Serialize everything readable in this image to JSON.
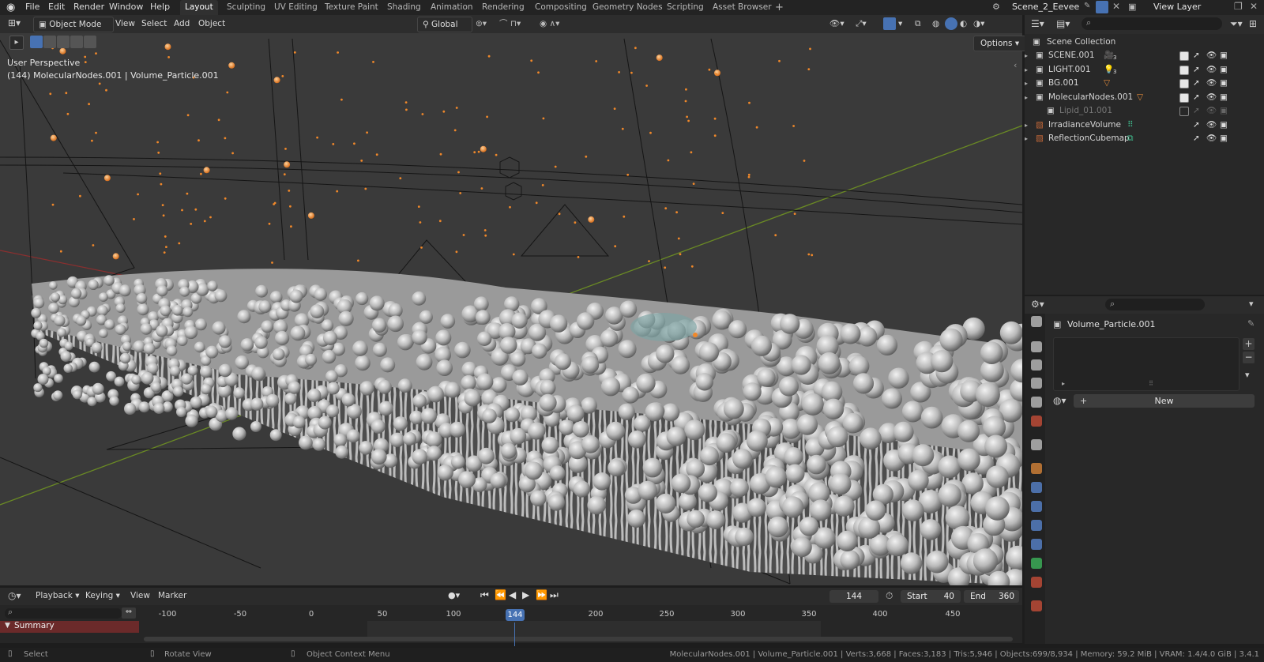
{
  "topbar": {
    "menus": [
      "File",
      "Edit",
      "Render",
      "Window",
      "Help"
    ],
    "workspaces": [
      "Layout",
      "Sculpting",
      "UV Editing",
      "Texture Paint",
      "Shading",
      "Animation",
      "Rendering",
      "Compositing",
      "Geometry Nodes",
      "Scripting",
      "Asset Browser"
    ],
    "active_workspace": "Layout",
    "add_tab": "+",
    "scene_name": "Scene_2_Eevee",
    "view_layer": "View Layer"
  },
  "viewport_header": {
    "mode": "Object Mode",
    "menus": [
      "View",
      "Select",
      "Add",
      "Object"
    ],
    "transform_orientation": "Global",
    "options_label": "Options"
  },
  "viewport_overlay": {
    "view_name": "User Perspective",
    "object_info": "(144) MolecularNodes.001 | Volume_Particle.001"
  },
  "outliner": {
    "root": "Scene Collection",
    "items": [
      {
        "label": "SCENE.001",
        "badge": "3",
        "checked": true,
        "dim": false
      },
      {
        "label": "LIGHT.001",
        "badge": "3",
        "checked": true,
        "dim": false
      },
      {
        "label": "BG.001",
        "badge": "",
        "checked": true,
        "dim": false
      },
      {
        "label": "MolecularNodes.001",
        "badge": "",
        "checked": true,
        "dim": false
      },
      {
        "label": "Lipid_01.001",
        "badge": "",
        "checked": false,
        "dim": true
      },
      {
        "label": "IrradianceVolume",
        "badge": "",
        "checked": null,
        "dim": false
      },
      {
        "label": "ReflectionCubemap",
        "badge": "",
        "checked": null,
        "dim": false
      }
    ]
  },
  "properties": {
    "object_name": "Volume_Particle.001",
    "new_button": "New"
  },
  "timeline": {
    "menus": [
      "Playback",
      "Keying",
      "View",
      "Marker"
    ],
    "current_frame": "144",
    "start_label": "Start",
    "start_value": "40",
    "end_label": "End",
    "end_value": "360",
    "summary_label": "Summary",
    "ticks": [
      "-100",
      "-50",
      "0",
      "50",
      "100",
      "144",
      "200",
      "250",
      "300",
      "350",
      "400",
      "450"
    ],
    "playhead_frame": "144"
  },
  "statusbar": {
    "select": "Select",
    "rotate": "Rotate View",
    "context_menu": "Object Context Menu",
    "stats": "MolecularNodes.001 | Volume_Particle.001 | Verts:3,668 | Faces:3,183 | Tris:5,946 | Objects:699/8,934 | Memory: 59.2 MiB | VRAM: 1.4/4.0 GiB | 3.4.1"
  },
  "colors": {
    "accent_blue": "#4772b3",
    "particle_orange": "#f0882a",
    "axis_green": "#6a8a24",
    "axis_red": "#8a2f2f",
    "summary_red": "#6b2a2a"
  }
}
